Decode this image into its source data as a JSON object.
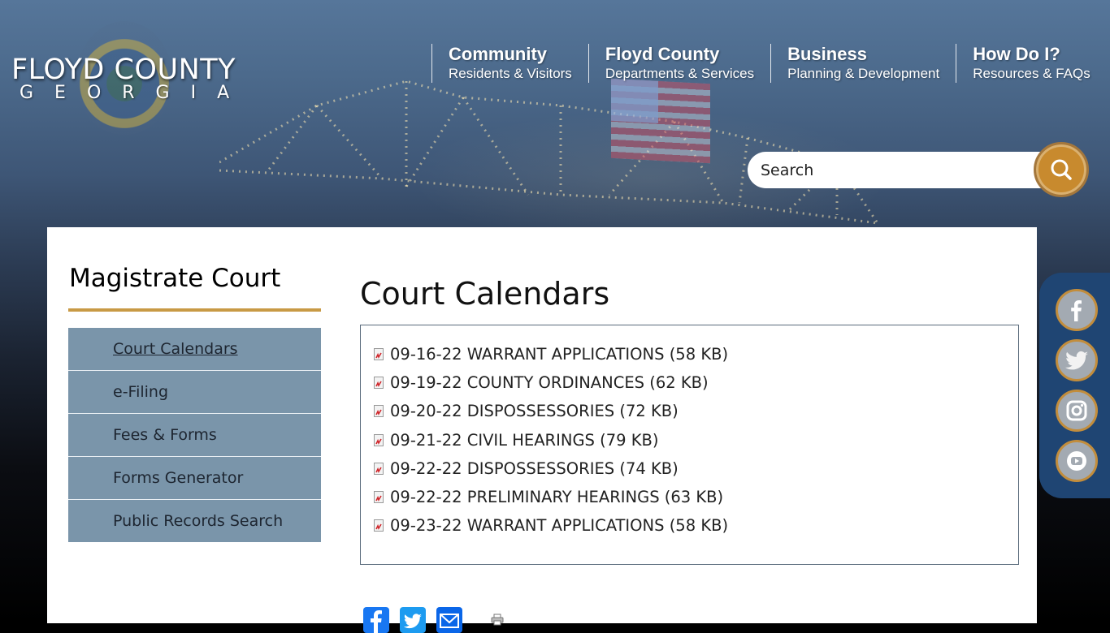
{
  "site": {
    "logo_title": "FLOYD COUNTY",
    "logo_subtitle": "GEORGIA"
  },
  "main_nav": [
    {
      "label": "Community",
      "sub": "Residents & Visitors"
    },
    {
      "label": "Floyd County",
      "sub": "Departments & Services"
    },
    {
      "label": "Business",
      "sub": "Planning & Development"
    },
    {
      "label": "How Do I?",
      "sub": "Resources & FAQs"
    }
  ],
  "search": {
    "placeholder": "Search",
    "value": "",
    "button_icon": "search-icon"
  },
  "sidebar": {
    "title": "Magistrate Court",
    "items": [
      {
        "label": "Court Calendars",
        "active": true
      },
      {
        "label": "e-Filing"
      },
      {
        "label": "Fees & Forms"
      },
      {
        "label": "Forms Generator"
      },
      {
        "label": "Public Records Search"
      }
    ]
  },
  "main": {
    "title": "Court Calendars",
    "documents": [
      {
        "label": "09-16-22 WARRANT APPLICATIONS (58 KB)",
        "icon": "pdf-icon"
      },
      {
        "label": "09-19-22 COUNTY ORDINANCES (62 KB)",
        "icon": "pdf-icon"
      },
      {
        "label": "09-20-22 DISPOSSESSORIES (72 KB)",
        "icon": "pdf-icon"
      },
      {
        "label": "09-21-22 CIVIL HEARINGS (79 KB)",
        "icon": "pdf-icon"
      },
      {
        "label": "09-22-22 DISPOSSESSORIES (74 KB)",
        "icon": "pdf-icon"
      },
      {
        "label": "09-22-22 PRELIMINARY HEARINGS (63 KB)",
        "icon": "pdf-icon"
      },
      {
        "label": "09-23-22 WARRANT APPLICATIONS (58 KB)",
        "icon": "pdf-icon"
      }
    ],
    "share": [
      {
        "name": "facebook-share",
        "icon": "facebook-icon",
        "color": "#1877f2"
      },
      {
        "name": "twitter-share",
        "icon": "twitter-icon",
        "color": "#1d9bf0"
      },
      {
        "name": "email-share",
        "icon": "email-icon",
        "color": "#0a66e8"
      }
    ],
    "print_icon": "print-icon"
  },
  "social_sidebar": [
    {
      "name": "facebook",
      "icon": "facebook-icon"
    },
    {
      "name": "twitter",
      "icon": "twitter-icon"
    },
    {
      "name": "instagram",
      "icon": "instagram-icon"
    },
    {
      "name": "youtube",
      "icon": "youtube-icon"
    }
  ],
  "colors": {
    "accent_gold": "#c89a45",
    "sidebar_bg": "#7a95aa",
    "social_panel": "#1f4573",
    "search_button": "#c88a2e"
  }
}
